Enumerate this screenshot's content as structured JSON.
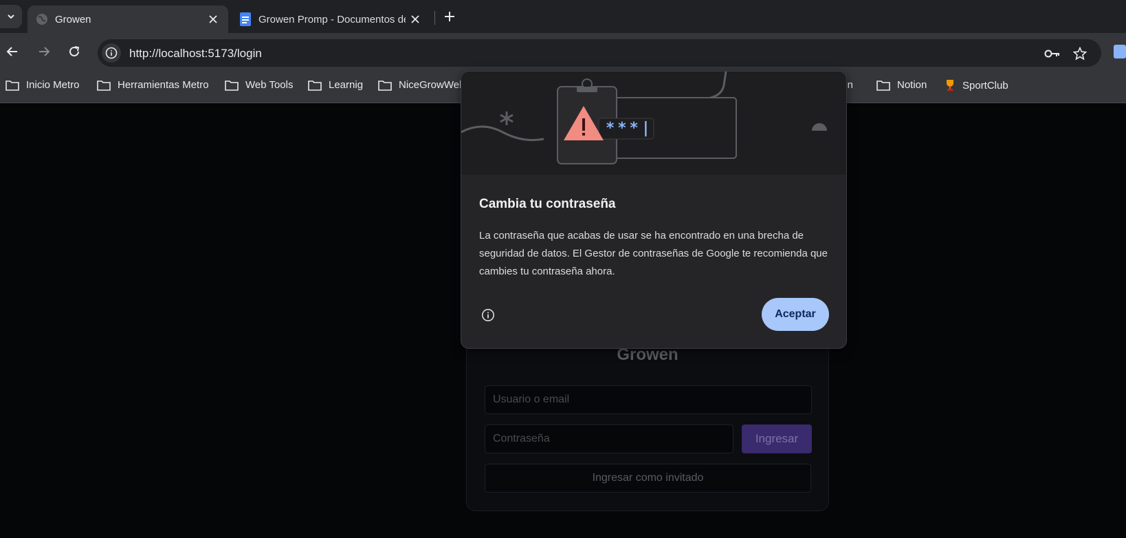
{
  "tabs": [
    {
      "title": "Growen",
      "icon": "globe-icon",
      "active": true
    },
    {
      "title": "Growen Promp - Documentos de Google",
      "icon": "docs-icon",
      "active": false
    }
  ],
  "toolbar": {
    "url": "http://localhost:5173/login"
  },
  "bookmarks": [
    {
      "label": "Inicio Metro",
      "icon": "folder-icon"
    },
    {
      "label": "Herramientas Metro",
      "icon": "folder-icon"
    },
    {
      "label": "Web Tools",
      "icon": "folder-icon"
    },
    {
      "label": "Learnig",
      "icon": "folder-icon"
    },
    {
      "label": "NiceGrowWeb",
      "icon": "folder-icon"
    },
    {
      "label": "ión",
      "icon": "none"
    },
    {
      "label": "Notion",
      "icon": "folder-icon"
    },
    {
      "label": "SportClub",
      "icon": "trophy-icon"
    }
  ],
  "login": {
    "brand": "Growen",
    "user_placeholder": "Usuario o email",
    "password_placeholder": "Contraseña",
    "submit_label": "Ingresar",
    "guest_label": "Ingresar como invitado",
    "accent_color": "#3a2a6e"
  },
  "dialog": {
    "title": "Cambia tu contraseña",
    "body": "La contraseña que acabas de usar se ha encontrado en una brecha de seguridad de datos. El Gestor de contraseñas de Google te recomienda que cambies tu contraseña ahora.",
    "accept_label": "Aceptar",
    "password_mask": "***|",
    "accent_color": "#a8c7fa",
    "warning_color": "#f28b82"
  }
}
